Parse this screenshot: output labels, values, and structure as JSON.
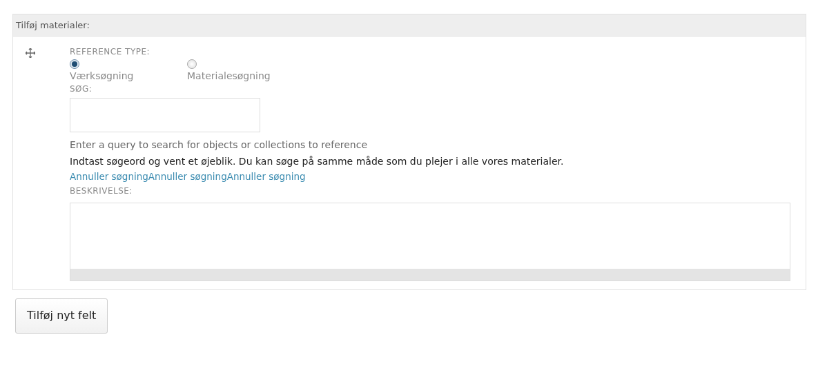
{
  "panel": {
    "title": "Tilføj materialer:",
    "reference_type": {
      "label": "REFERENCE TYPE:",
      "options": [
        {
          "label": "Værksøgning",
          "selected": true
        },
        {
          "label": "Materialesøgning",
          "selected": false
        }
      ]
    },
    "search": {
      "label": "SØG:",
      "help": "Enter a query to search for objects or collections to reference",
      "hint": "Indtast søgeord og vent et øjeblik. Du kan søge på samme måde som du plejer i alle vores materialer.",
      "cancel_links": [
        "Annuller søgning",
        "Annuller søgning",
        "Annuller søgning"
      ]
    },
    "description": {
      "label": "BESKRIVELSE:"
    }
  },
  "add_button": "Tilføj nyt felt"
}
